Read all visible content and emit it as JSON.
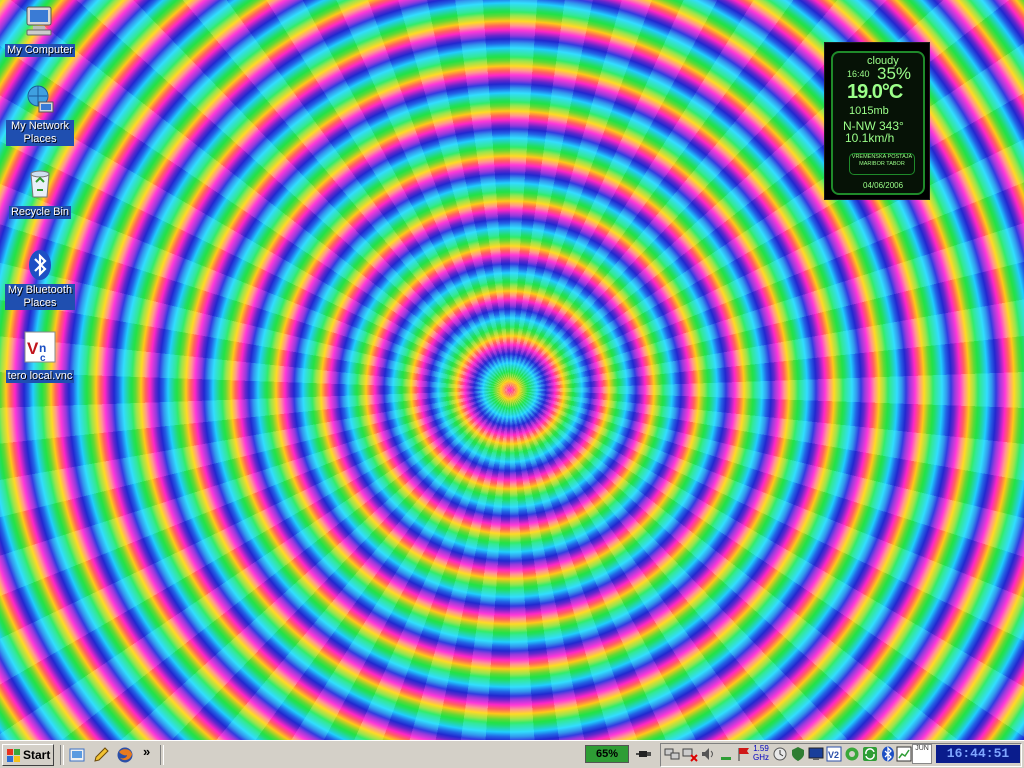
{
  "desktop": {
    "icons": [
      {
        "label": "My Computer",
        "icon": "computer-icon"
      },
      {
        "label": "My Network Places",
        "icon": "network-icon"
      },
      {
        "label": "Recycle Bin",
        "icon": "recycle-bin-icon"
      },
      {
        "label": "My Bluetooth Places",
        "icon": "bluetooth-icon"
      },
      {
        "label": "tero local.vnc",
        "icon": "vnc-icon"
      }
    ]
  },
  "weather": {
    "condition": "cloudy",
    "time": "16:40",
    "humidity": "35%",
    "temperature": "19.0°C",
    "pressure": "1015mb",
    "wind_direction": "N-NW 343°",
    "wind_speed": "10.1km/h",
    "station": "VREMENSKA POSTAJA MARIBOR TABOR",
    "date": "04/06/2006"
  },
  "taskbar": {
    "start_label": "Start",
    "quicklaunch_more": "»",
    "battery": "65%",
    "cpu": "1.59 GHz",
    "calendar": "JUN",
    "clock": "16:44:51"
  },
  "colors": {
    "taskbar": "#d4d0c8",
    "icon_label_bg": "#1f4fb0",
    "widget_green": "#1f8a2a",
    "clock_bg": "#0a1c8c"
  }
}
